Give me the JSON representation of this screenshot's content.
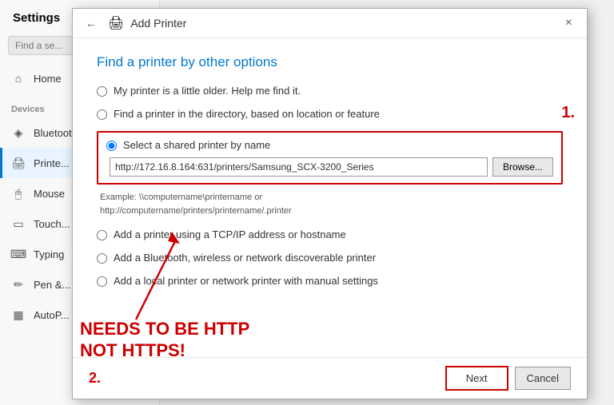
{
  "settings": {
    "title": "Settings",
    "search_placeholder": "Find a se...",
    "nav_items": [
      {
        "id": "home",
        "label": "Home",
        "icon": "⌂"
      },
      {
        "id": "bluetooth",
        "label": "Bluetooth",
        "icon": "◈"
      },
      {
        "id": "printers",
        "label": "Printe...",
        "icon": "🖨"
      },
      {
        "id": "mouse",
        "label": "Mouse",
        "icon": "🖱"
      },
      {
        "id": "touchpad",
        "label": "Touch...",
        "icon": "▭"
      },
      {
        "id": "typing",
        "label": "Typing",
        "icon": "⌨"
      },
      {
        "id": "pen",
        "label": "Pen &...",
        "icon": "✏"
      },
      {
        "id": "autop",
        "label": "AutoP...",
        "icon": "▦"
      }
    ]
  },
  "dialog": {
    "title": "Add Printer",
    "close_label": "×",
    "back_label": "←",
    "section_heading": "Find a printer by other options",
    "options": [
      {
        "id": "opt1",
        "label": "My printer is a little older. Help me find it."
      },
      {
        "id": "opt2",
        "label": "Find a printer in the directory, based on location or feature"
      },
      {
        "id": "opt3",
        "label": "Select a shared printer by name",
        "selected": true
      },
      {
        "id": "opt4",
        "label": "Add a printer using a TCP/IP address or hostname"
      },
      {
        "id": "opt5",
        "label": "Add a Bluetooth, wireless or network discoverable printer"
      },
      {
        "id": "opt6",
        "label": "Add a local printer or network printer with manual settings"
      }
    ],
    "url_value": "http://172.16.8.164:631/printers/Samsung_SCX-3200_Series",
    "browse_label": "Browse...",
    "example_line1": "Example: \\\\computername\\printername or",
    "example_line2": "http://computername/printers/printername/.printer",
    "annotation_1": "1.",
    "annotation_2": "2.",
    "big_annotation_line1": "NEEDS TO BE HTTP",
    "big_annotation_line2": "NOT HTTPS!",
    "next_label": "Next",
    "cancel_label": "Cancel"
  }
}
